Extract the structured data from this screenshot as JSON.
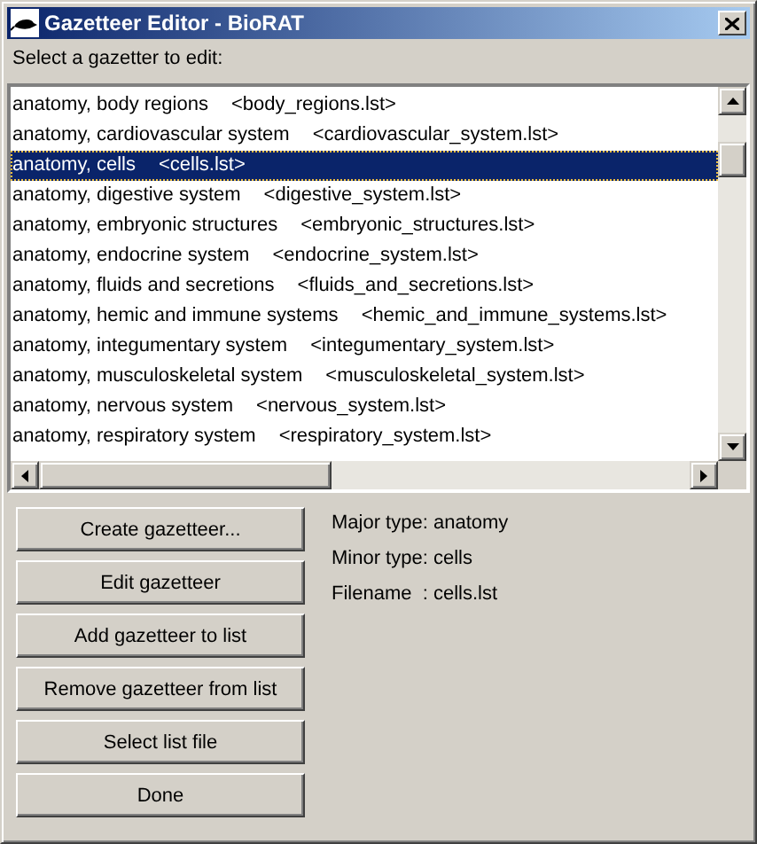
{
  "window": {
    "title": "Gazetteer Editor - BioRAT"
  },
  "prompt": "Select a gazetter to edit:",
  "gazetteers": [
    {
      "name": "anatomy, body regions",
      "file": "<body_regions.lst>",
      "selected": false
    },
    {
      "name": "anatomy, cardiovascular system",
      "file": "<cardiovascular_system.lst>",
      "selected": false
    },
    {
      "name": "anatomy, cells",
      "file": "<cells.lst>",
      "selected": true
    },
    {
      "name": "anatomy, digestive system",
      "file": "<digestive_system.lst>",
      "selected": false
    },
    {
      "name": "anatomy, embryonic structures",
      "file": "<embryonic_structures.lst>",
      "selected": false
    },
    {
      "name": "anatomy, endocrine system",
      "file": "<endocrine_system.lst>",
      "selected": false
    },
    {
      "name": "anatomy, fluids and secretions",
      "file": "<fluids_and_secretions.lst>",
      "selected": false
    },
    {
      "name": "anatomy, hemic and immune systems",
      "file": "<hemic_and_immune_systems.lst>",
      "selected": false
    },
    {
      "name": "anatomy, integumentary system",
      "file": "<integumentary_system.lst>",
      "selected": false
    },
    {
      "name": "anatomy, musculoskeletal system",
      "file": "<musculoskeletal_system.lst>",
      "selected": false
    },
    {
      "name": "anatomy, nervous system",
      "file": "<nervous_system.lst>",
      "selected": false
    },
    {
      "name": "anatomy, respiratory system",
      "file": "<respiratory_system.lst>",
      "selected": false
    }
  ],
  "buttons": [
    "Create gazetteer...",
    "Edit gazetteer",
    "Add gazetteer to list",
    "Remove gazetteer from list",
    "Select list file",
    "Done"
  ],
  "details": [
    "Major type: anatomy",
    "Minor type: cells",
    "Filename  : cells.lst"
  ]
}
